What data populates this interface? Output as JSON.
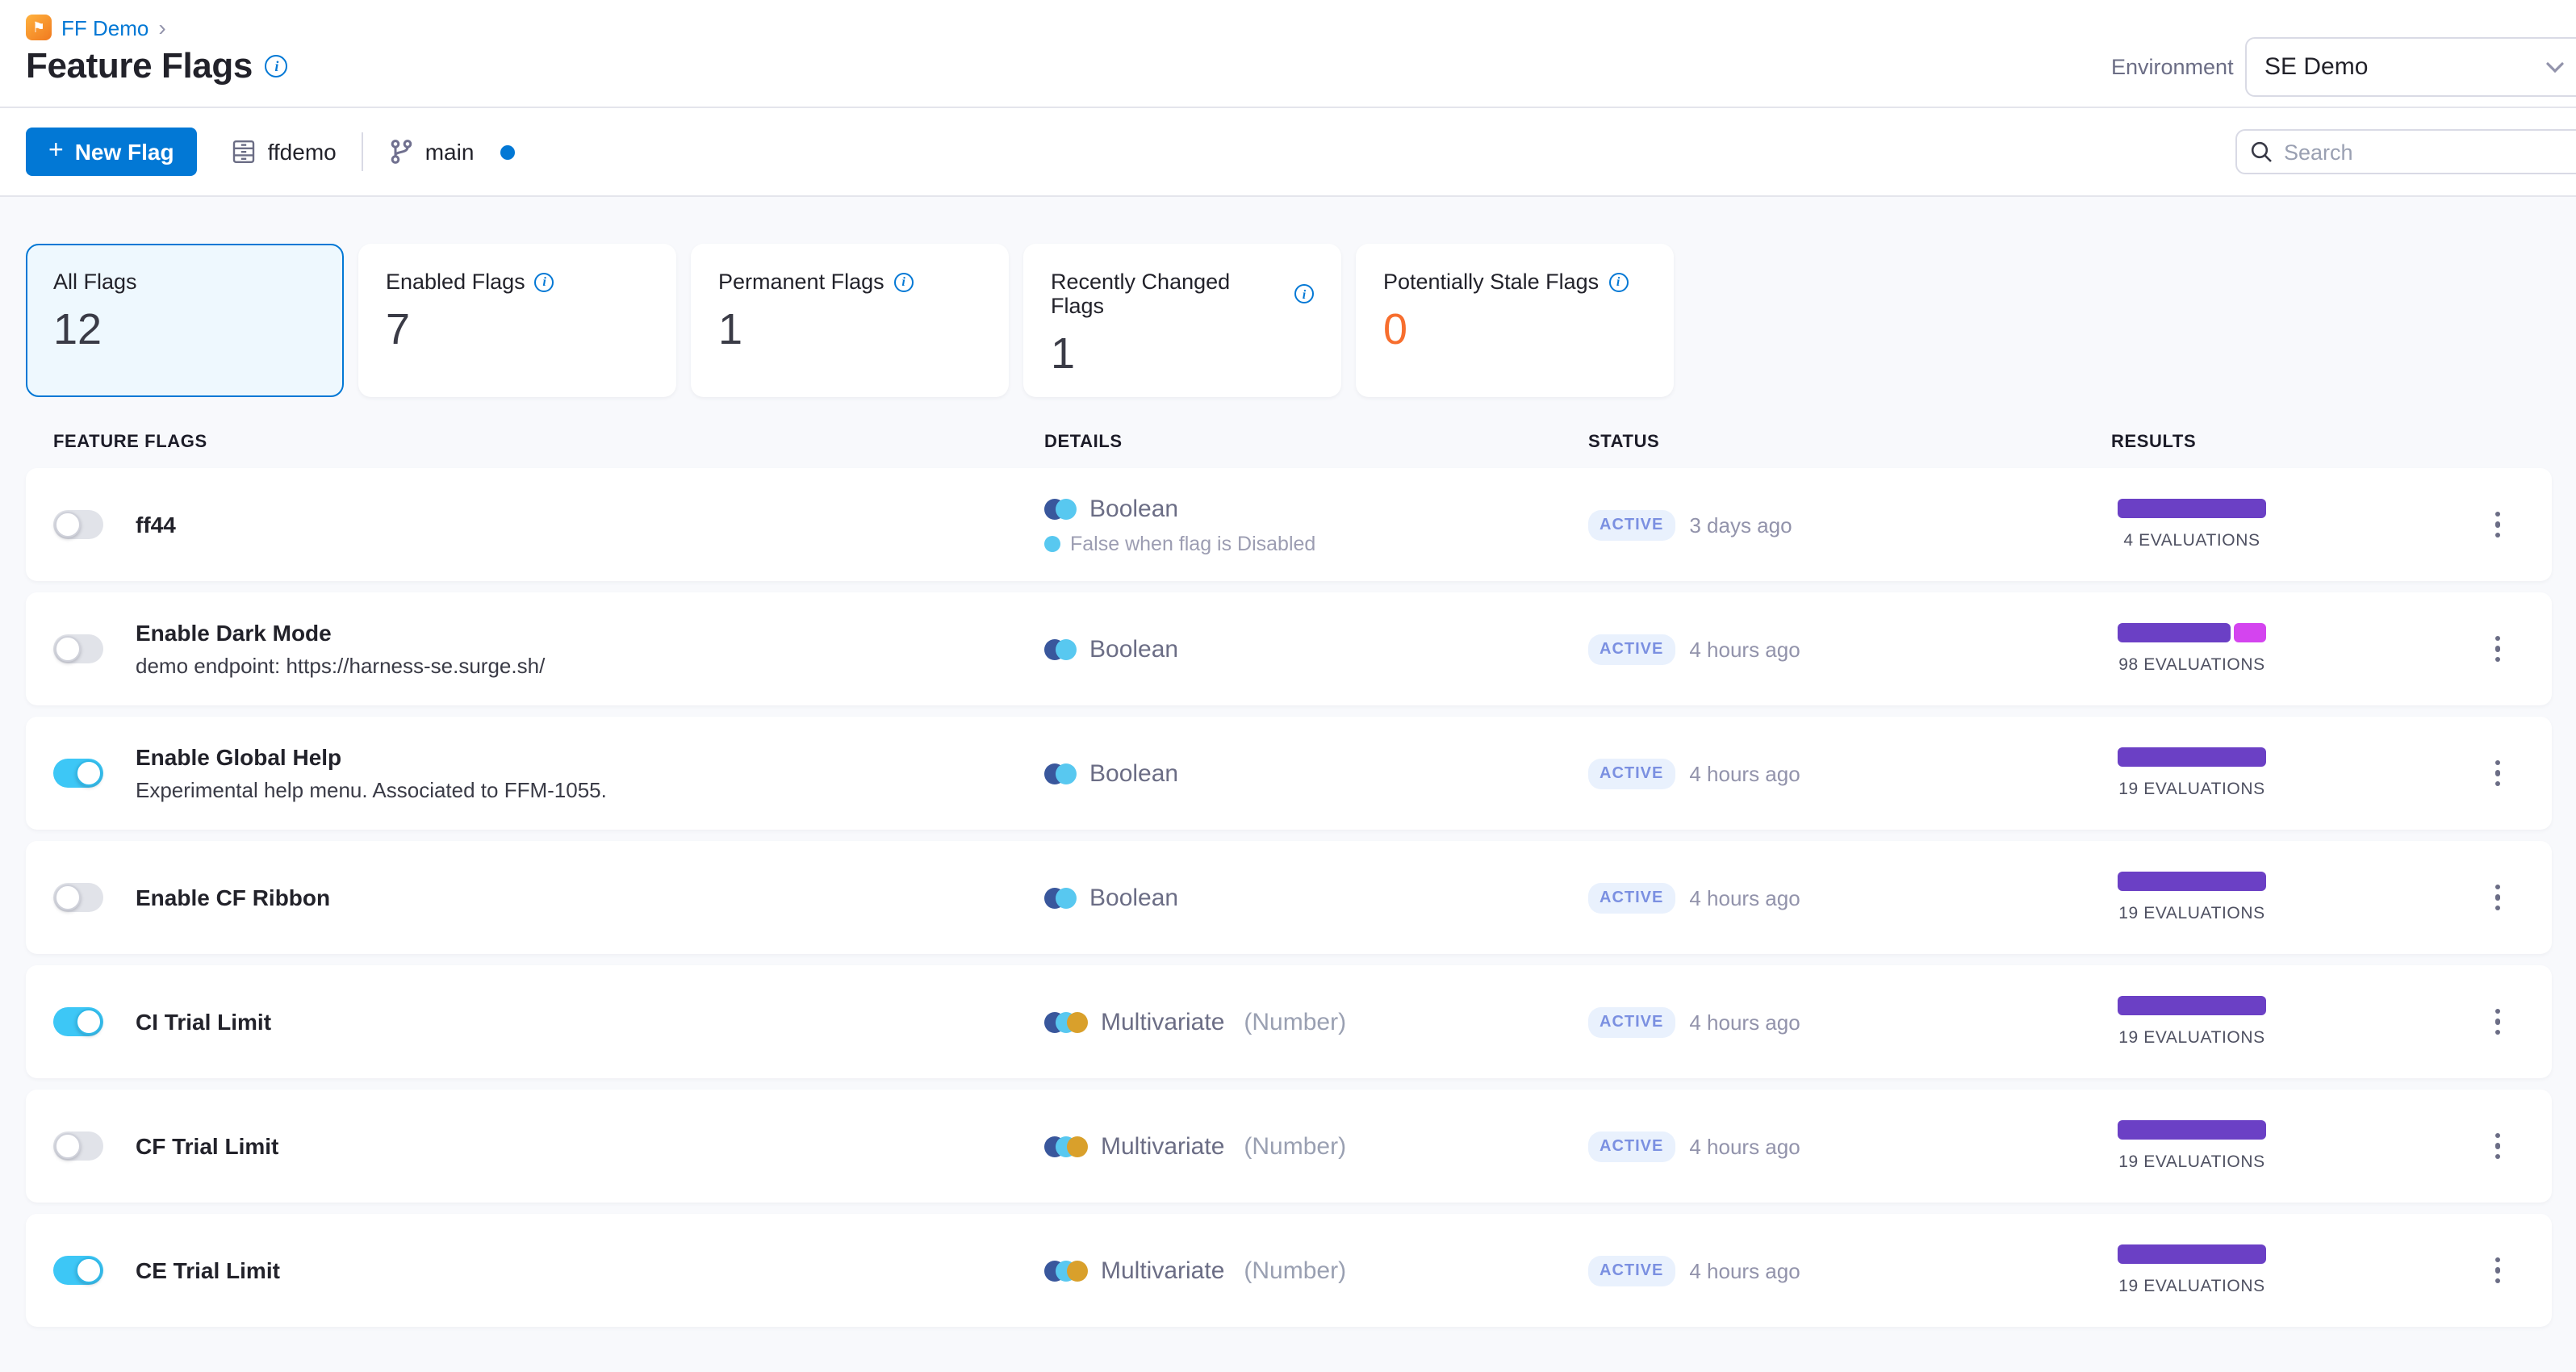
{
  "page": {
    "breadcrumb": "FF Demo",
    "breadcrumb_chevron": "›",
    "title": "Feature Flags",
    "environment_label": "Environment",
    "environment_value": "SE Demo"
  },
  "toolbar": {
    "new_flag_label": "New Flag",
    "repo_name": "ffdemo",
    "branch_name": "main",
    "search_placeholder": "Search"
  },
  "icons": {
    "ff_logo_glyph": "⚑",
    "plus_icon": "+",
    "info_icon": "i"
  },
  "colors": {
    "accent_blue": "#0278d5",
    "toggle_on_cyan": "#3dc7f6",
    "bar_purple": "#6b40c5",
    "bar_magenta": "#d444ef",
    "stale_orange": "#f76e2e",
    "badge_bg": "#e9f1fd",
    "badge_text": "#7b90e1",
    "type_dot_navy": "#39579c",
    "type_dot_cyan": "#58c8f0",
    "type_dot_gold": "#d9a02b",
    "content_bg": "#f8f9fc"
  },
  "filters": [
    {
      "label": "All Flags",
      "count": "12",
      "info": false,
      "selected": true
    },
    {
      "label": "Enabled Flags",
      "count": "7",
      "info": true
    },
    {
      "label": "Permanent Flags",
      "count": "1",
      "info": true
    },
    {
      "label": "Recently Changed Flags",
      "count": "1",
      "info": true
    },
    {
      "label": "Potentially Stale Flags",
      "count": "0",
      "info": true,
      "count_color": "#f76e2e"
    }
  ],
  "table": {
    "headers": [
      "FEATURE FLAGS",
      "DETAILS",
      "STATUS",
      "RESULTS"
    ],
    "rows": [
      {
        "name": "ff44",
        "enabled": false,
        "type": "Boolean",
        "type_dots": [
          "#39579c",
          "#58c8f0"
        ],
        "note": "False when flag is Disabled",
        "note_color": "#58c8f0",
        "status": "ACTIVE",
        "updated": "3 days ago",
        "evaluations": "4 EVALUATIONS",
        "segments": [
          {
            "color": "#6b40c5",
            "pct": 100
          }
        ]
      },
      {
        "name": "Enable Dark Mode",
        "description": "demo endpoint: https://harness-se.surge.sh/",
        "enabled": false,
        "type": "Boolean",
        "type_dots": [
          "#39579c",
          "#58c8f0"
        ],
        "status": "ACTIVE",
        "updated": "4 hours ago",
        "evaluations": "98 EVALUATIONS",
        "segments": [
          {
            "color": "#6b40c5",
            "pct": 76
          },
          {
            "color": "#d444ef",
            "pct": 22
          }
        ]
      },
      {
        "name": "Enable Global Help",
        "description": "Experimental help menu. Associated to FFM-1055.",
        "enabled": true,
        "type": "Boolean",
        "type_dots": [
          "#39579c",
          "#58c8f0"
        ],
        "status": "ACTIVE",
        "updated": "4 hours ago",
        "evaluations": "19 EVALUATIONS",
        "segments": [
          {
            "color": "#6b40c5",
            "pct": 100
          }
        ]
      },
      {
        "name": "Enable CF Ribbon",
        "enabled": false,
        "type": "Boolean",
        "type_dots": [
          "#39579c",
          "#58c8f0"
        ],
        "status": "ACTIVE",
        "updated": "4 hours ago",
        "evaluations": "19 EVALUATIONS",
        "segments": [
          {
            "color": "#6b40c5",
            "pct": 100
          }
        ]
      },
      {
        "name": "CI Trial Limit",
        "enabled": true,
        "type": "Multivariate",
        "type_detail": "(Number)",
        "type_dots": [
          "#39579c",
          "#58c8f0",
          "#d9a02b"
        ],
        "status": "ACTIVE",
        "updated": "4 hours ago",
        "evaluations": "19 EVALUATIONS",
        "segments": [
          {
            "color": "#6b40c5",
            "pct": 100
          }
        ]
      },
      {
        "name": "CF Trial Limit",
        "enabled": false,
        "type": "Multivariate",
        "type_detail": "(Number)",
        "type_dots": [
          "#39579c",
          "#58c8f0",
          "#d9a02b"
        ],
        "status": "ACTIVE",
        "updated": "4 hours ago",
        "evaluations": "19 EVALUATIONS",
        "segments": [
          {
            "color": "#6b40c5",
            "pct": 100
          }
        ]
      },
      {
        "name": "CE Trial Limit",
        "enabled": true,
        "type": "Multivariate",
        "type_detail": "(Number)",
        "type_dots": [
          "#39579c",
          "#58c8f0",
          "#d9a02b"
        ],
        "status": "ACTIVE",
        "updated": "4 hours ago",
        "evaluations": "19 EVALUATIONS",
        "segments": [
          {
            "color": "#6b40c5",
            "pct": 100
          }
        ]
      }
    ]
  }
}
